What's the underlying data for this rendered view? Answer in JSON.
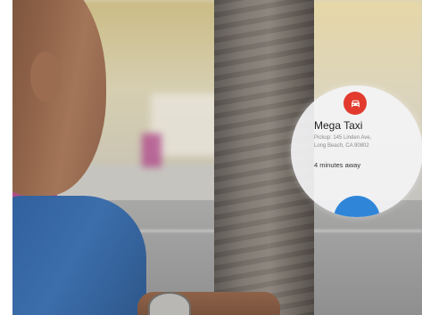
{
  "notification": {
    "title": "Mega Taxi",
    "address_line1": "Pickup: 145 Linden Ave,",
    "address_line2": "Long Beach, CA 90802",
    "eta": "4 minutes away",
    "app_icon": "car-icon",
    "accent_color": "#e23b2e",
    "action_color": "#2f86d9"
  }
}
